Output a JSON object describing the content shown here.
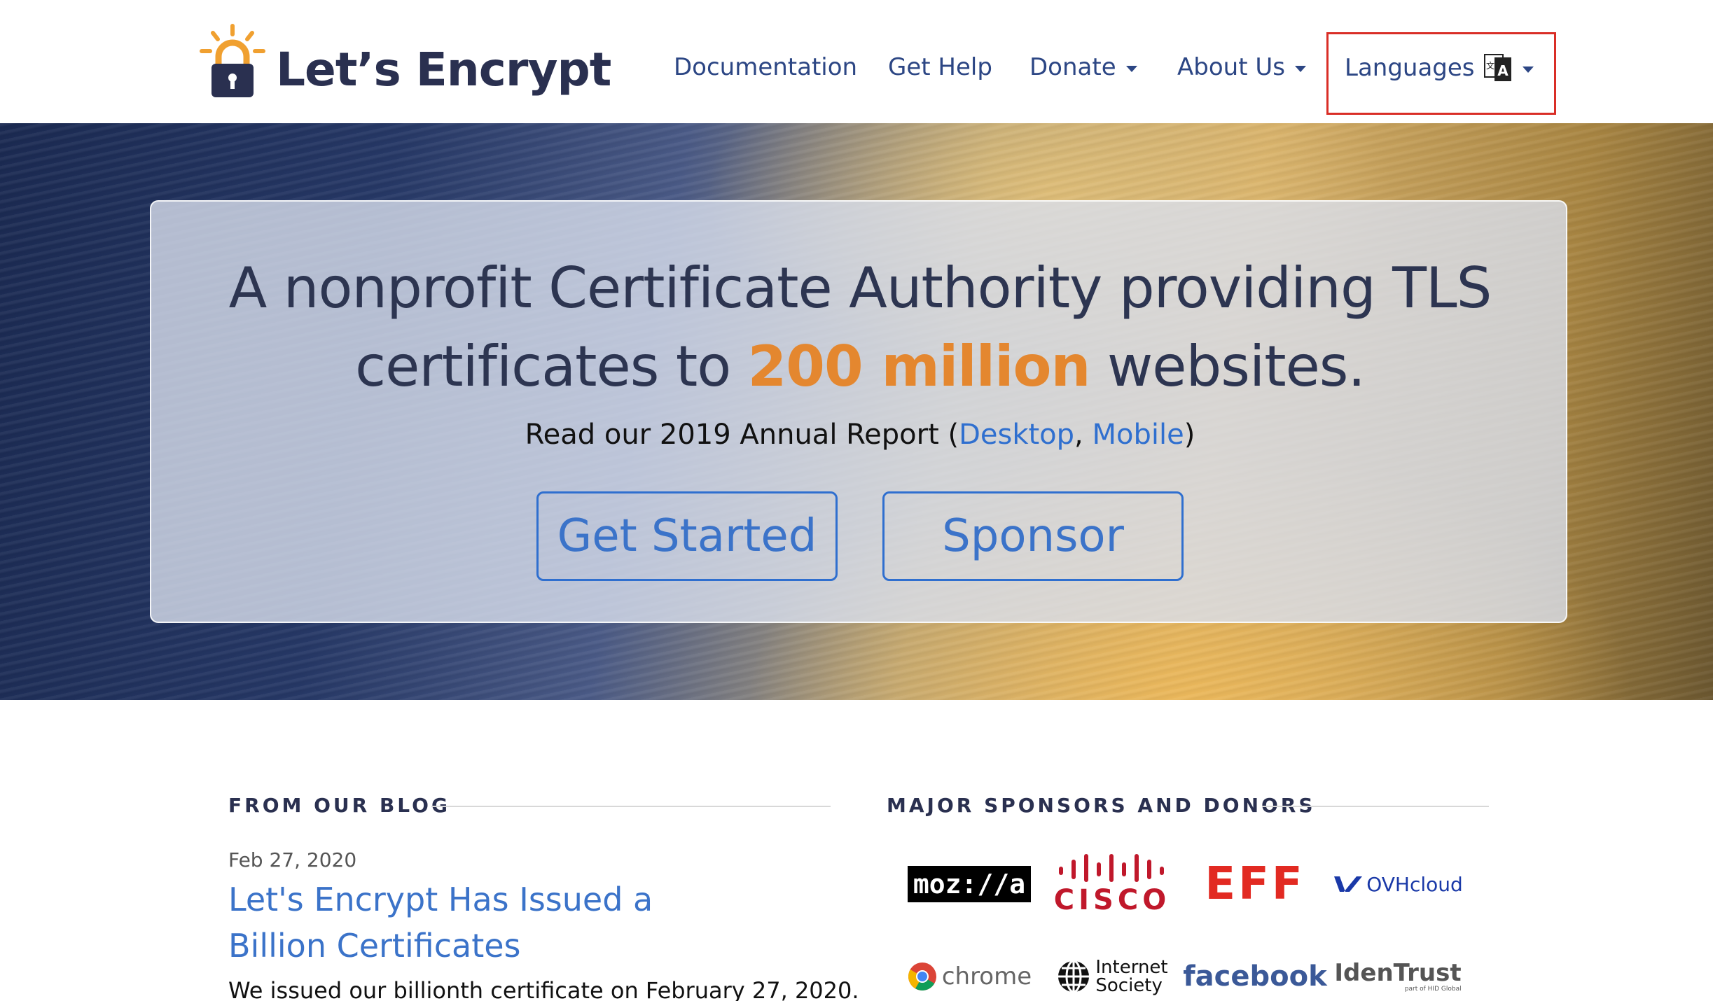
{
  "header": {
    "logo_text": "Let’s Encrypt",
    "nav": {
      "documentation": "Documentation",
      "get_help": "Get Help",
      "donate": "Donate",
      "about_us": "About Us",
      "languages": "Languages"
    }
  },
  "hero": {
    "title_line1": "A nonprofit Certificate Authority providing TLS",
    "title_line2_pre": "certificates to ",
    "title_highlight": "200 million",
    "title_line2_post": " websites.",
    "report_pre": "Read our 2019 Annual Report (",
    "report_desktop": "Desktop",
    "report_sep": ", ",
    "report_mobile": "Mobile",
    "report_post": ")",
    "get_started": "Get Started",
    "sponsor": "Sponsor"
  },
  "blog": {
    "heading": "FROM OUR BLOG",
    "date": "Feb 27, 2020",
    "title": "Let's Encrypt Has Issued a Billion Certificates",
    "excerpt": "We issued our billionth certificate on February 27, 2020."
  },
  "sponsors": {
    "heading": "MAJOR SPONSORS AND DONORS",
    "mozilla": "moz://a",
    "cisco": "CISCO",
    "eff": "EFF",
    "ovh": "OVHcloud",
    "chrome": "chrome",
    "isoc_line1": "Internet",
    "isoc_line2": "Society",
    "facebook": "facebook",
    "identrust": "IdenTrust",
    "identrust_sub": "part of HID Global"
  },
  "colors": {
    "nav_text": "#2c4684",
    "highlight": "#e4872f",
    "link": "#3b73c9",
    "focus_box": "#d92e26"
  }
}
